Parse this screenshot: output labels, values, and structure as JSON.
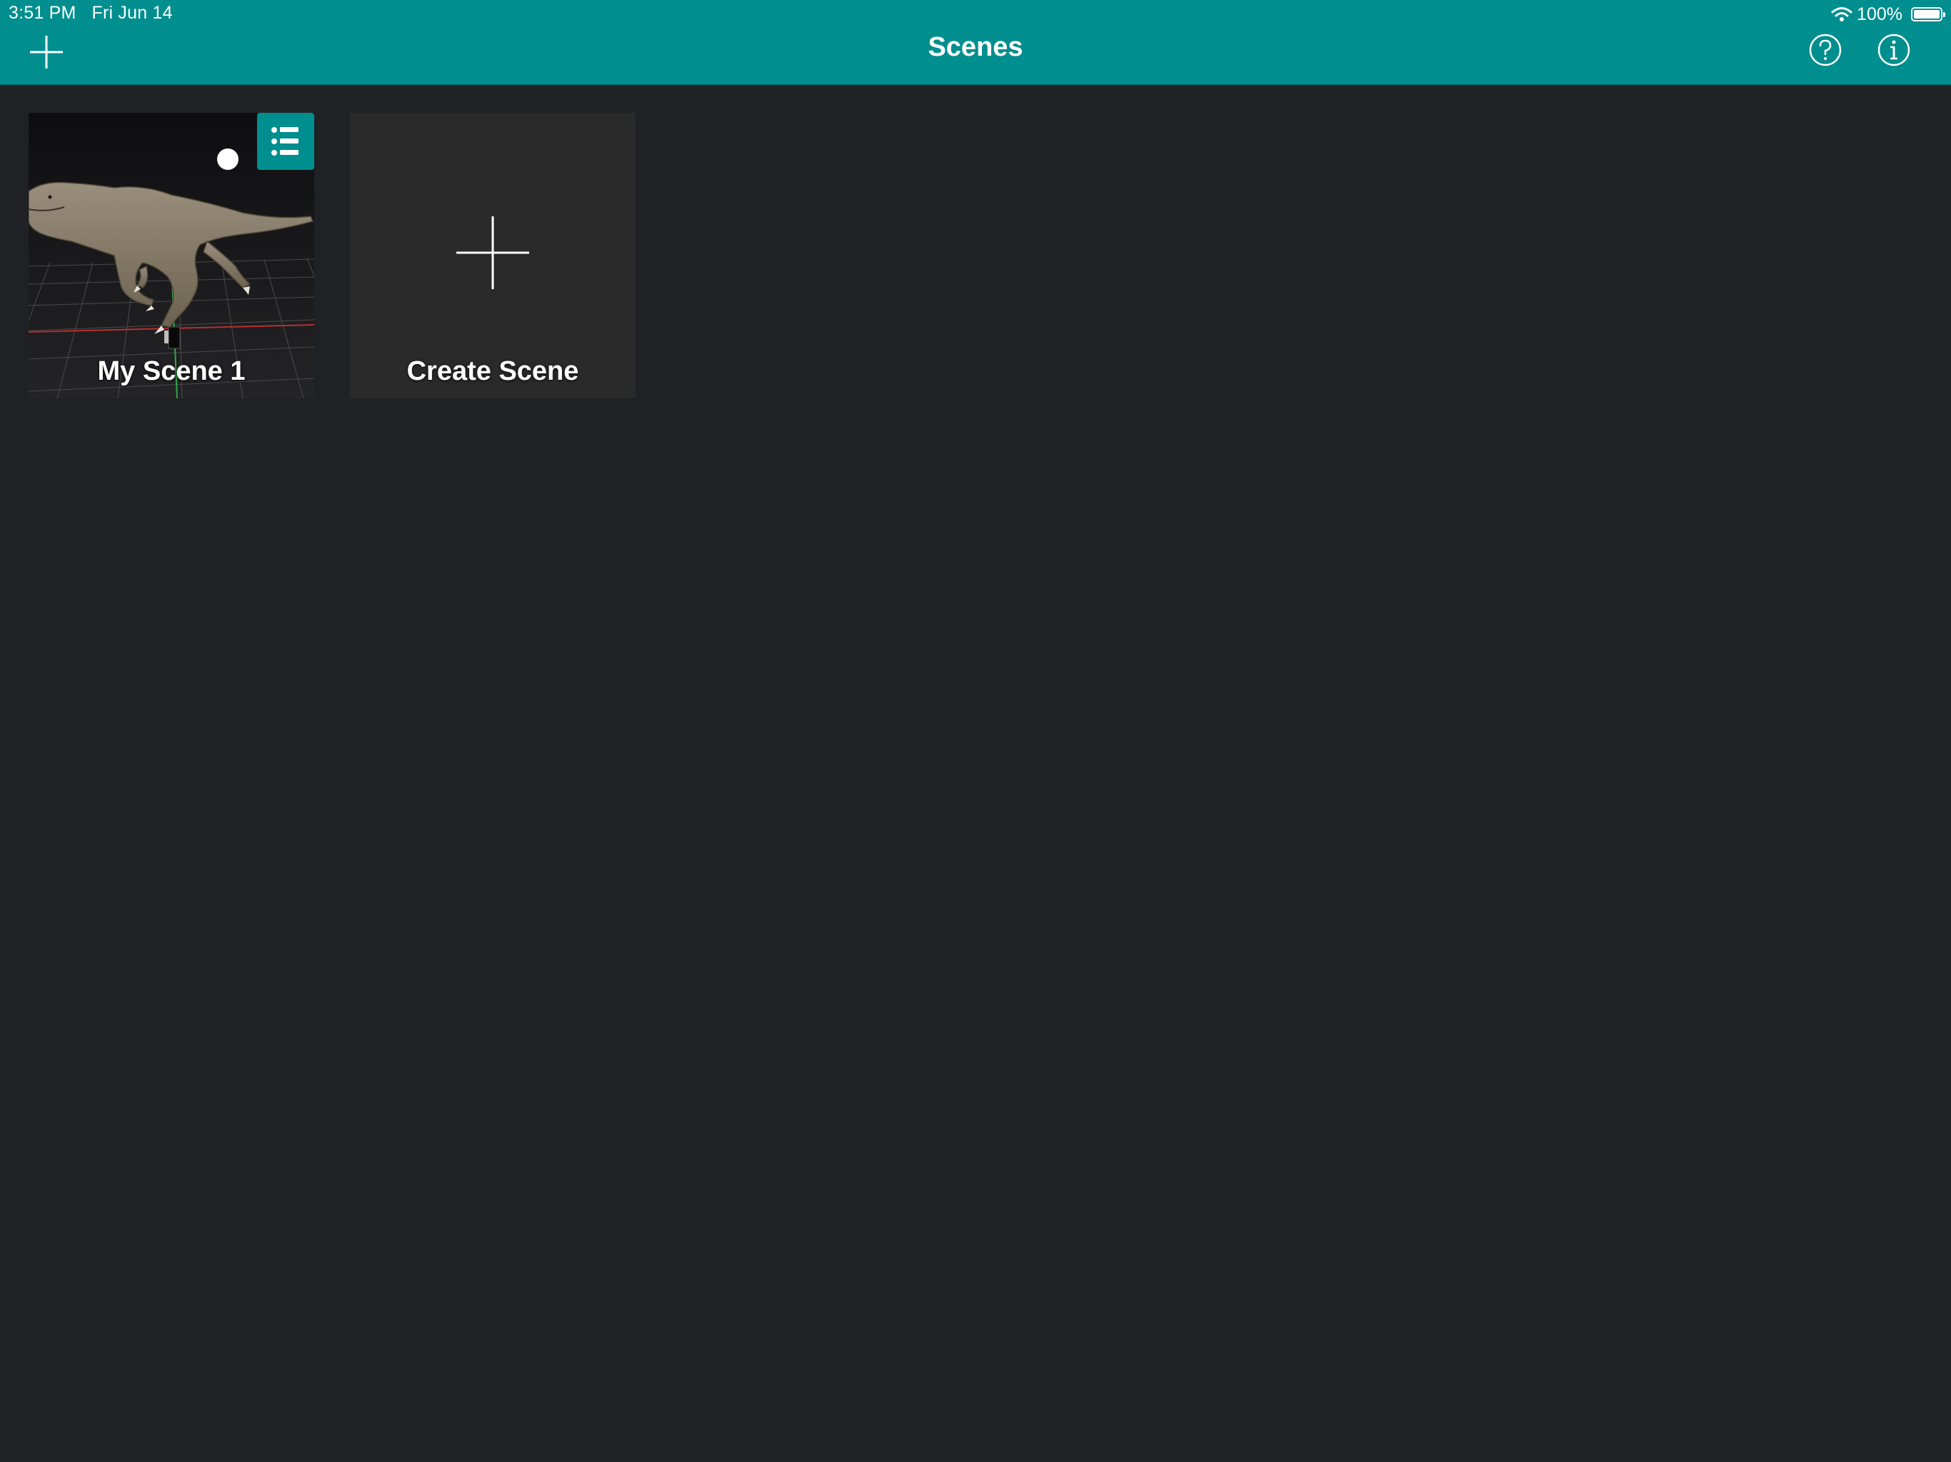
{
  "status_bar": {
    "time": "3:51 PM",
    "date": "Fri Jun 14",
    "battery": "100%"
  },
  "nav": {
    "title": "Scenes",
    "add_icon": "plus-icon",
    "help_icon": "question-circle-icon",
    "info_icon": "info-circle-icon"
  },
  "scenes": [
    {
      "name": "My Scene 1",
      "thumbnail": "t-rex-3d-preview",
      "menu_icon": "list-icon"
    }
  ],
  "create_card": {
    "label": "Create Scene",
    "icon": "plus-icon"
  },
  "colors": {
    "accent": "#008E8E",
    "background": "#202125",
    "card": "#2A2A2B"
  }
}
